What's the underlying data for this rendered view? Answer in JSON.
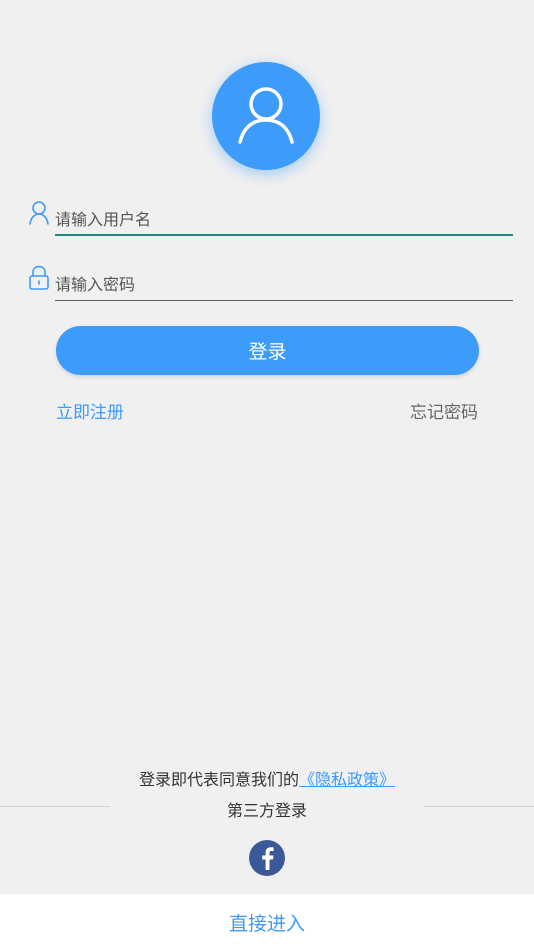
{
  "login": {
    "username_placeholder": "请输入用户名",
    "password_placeholder": "请输入密码",
    "login_label": "登录",
    "register_label": "立即注册",
    "forgot_label": "忘记密码"
  },
  "footer": {
    "agreement_prefix": "登录即代表同意我们的",
    "privacy_policy_link": "《隐私政策》",
    "third_party_title": "第三方登录",
    "direct_enter_label": "直接进入"
  },
  "icons": {
    "avatar": "user-icon",
    "username": "user-outline-icon",
    "password": "lock-icon",
    "facebook": "facebook-icon"
  },
  "colors": {
    "accent": "#3d9bfa",
    "facebook": "#3b5998",
    "background": "#f0f0f0",
    "focused_underline": "#1f8a7d"
  }
}
